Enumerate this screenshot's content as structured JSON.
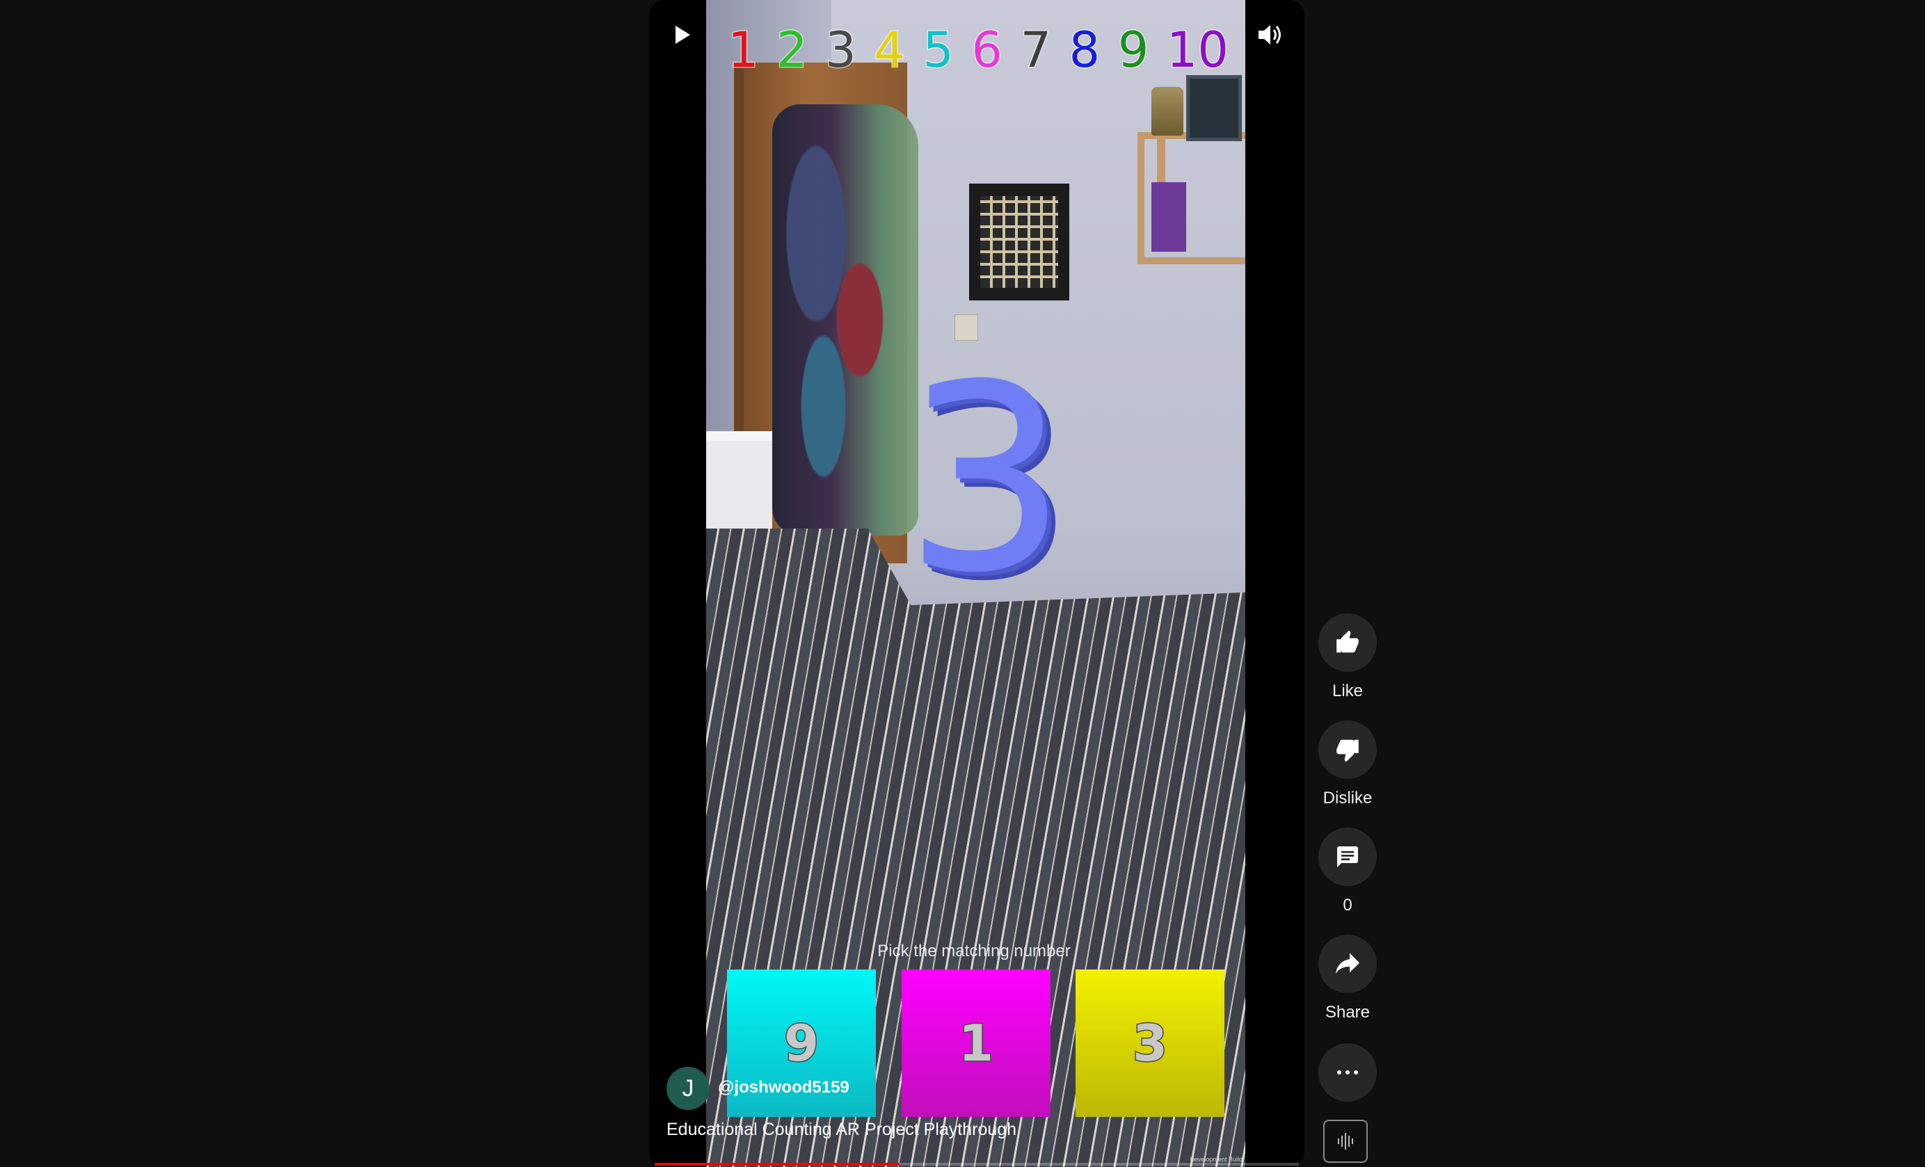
{
  "counting_row": [
    {
      "label": "1",
      "color": "#e0141b"
    },
    {
      "label": "2",
      "color": "#2ebf2a"
    },
    {
      "label": "3",
      "color": "#4a4a4a"
    },
    {
      "label": "4",
      "color": "#e2d30c"
    },
    {
      "label": "5",
      "color": "#11c2c8"
    },
    {
      "label": "6",
      "color": "#e13bd3"
    },
    {
      "label": "7",
      "color": "#3e3e3e"
    },
    {
      "label": "8",
      "color": "#1a1fd6"
    },
    {
      "label": "9",
      "color": "#1e8f1f"
    },
    {
      "label": "10",
      "color": "#8a10c7"
    }
  ],
  "video": {
    "target_number": "3",
    "prompt": "Pick the matching number",
    "answers": [
      "9",
      "1",
      "3"
    ],
    "watermark": "Development Build",
    "progress": 0.38
  },
  "channel": {
    "avatar_letter": "J",
    "handle": "@joshwood5159"
  },
  "title": "Educational Counting AR Project Playthrough",
  "actions": {
    "like_label": "Like",
    "dislike_label": "Dislike",
    "comment_count": "0",
    "share_label": "Share"
  },
  "icons": {
    "play": "play-icon",
    "volume": "volume-icon",
    "like": "thumbs-up-icon",
    "dislike": "thumbs-down-icon",
    "comment": "comment-icon",
    "share": "share-arrow-icon",
    "more": "more-horizontal-icon",
    "remix": "audio-waveform-icon"
  },
  "colors": {
    "background": "#0f0f0f",
    "action_circle": "#272727",
    "progress": "#ff0000"
  }
}
